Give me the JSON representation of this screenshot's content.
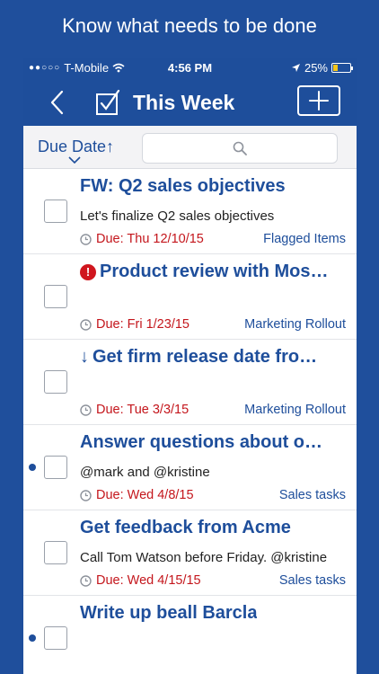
{
  "promo": {
    "headline": "Know what needs to be done"
  },
  "status_bar": {
    "carrier": "T-Mobile",
    "time": "4:56 PM",
    "battery": "25%",
    "battery_level": 0.25
  },
  "nav": {
    "title": "This Week"
  },
  "filter": {
    "sort_label": "Due Date↑",
    "search_placeholder": ""
  },
  "colors": {
    "brand_blue": "#1e4e9b",
    "due_red": "#c4161c",
    "background": "#1f4f9c"
  },
  "tasks": [
    {
      "title": "FW: Q2 sales objectives",
      "note": "Let's finalize Q2 sales objectives",
      "due": "Due: Thu 12/10/15",
      "category": "Flagged Items",
      "marker": "",
      "dot": false
    },
    {
      "title": "Product review with Mos…",
      "note": "",
      "due": "Due: Fri 1/23/15",
      "category": "Marketing Rollout",
      "marker": "!",
      "dot": false
    },
    {
      "title": "Get firm release date fro…",
      "note": "",
      "due": "Due: Tue 3/3/15",
      "category": "Marketing Rollout",
      "marker": "↓",
      "dot": false
    },
    {
      "title": "Answer questions about o…",
      "note": "@mark and @kristine",
      "due": "Due: Wed 4/8/15",
      "category": "Sales tasks",
      "marker": "",
      "dot": true
    },
    {
      "title": "Get feedback from Acme",
      "note": "Call Tom Watson before Friday. @kristine",
      "due": "Due: Wed 4/15/15",
      "category": "Sales tasks",
      "marker": "",
      "dot": false
    },
    {
      "title": "Write up beall Barcla",
      "note": "",
      "due": "",
      "category": "",
      "marker": "",
      "dot": true
    }
  ]
}
